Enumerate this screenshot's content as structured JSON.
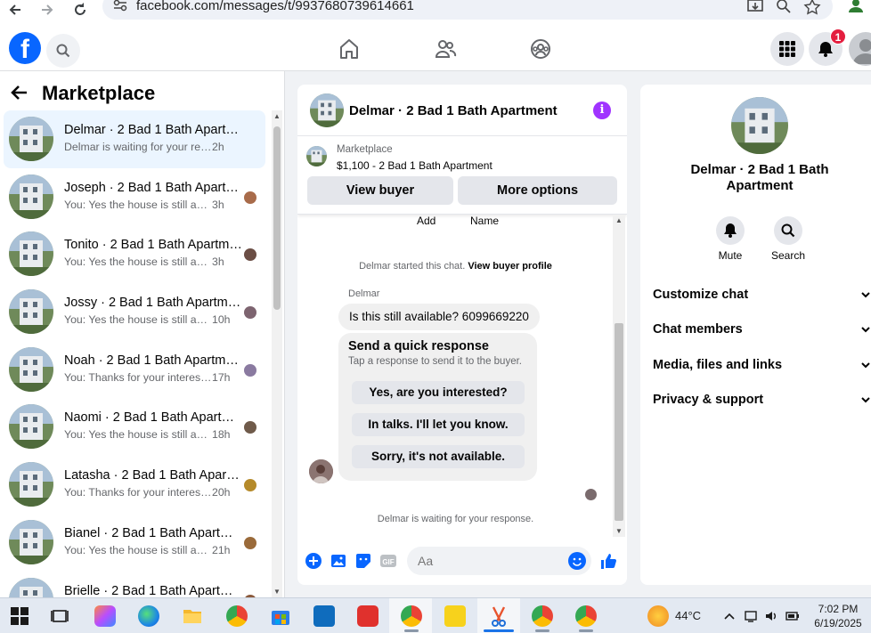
{
  "browser": {
    "url": "facebook.com/messages/t/9937680739614661"
  },
  "topnav": {
    "logo": "f",
    "notification_count": "1"
  },
  "sidebar": {
    "title": "Marketplace",
    "conversations": [
      {
        "title": "Delmar · 2 Bad 1 Bath Apartment",
        "preview": "Delmar is waiting for your response. ·",
        "time": "2h",
        "active": true
      },
      {
        "title": "Joseph · 2 Bad 1 Bath Apartment",
        "preview": "You: Yes the house is still available",
        "time": "3h"
      },
      {
        "title": "Tonito · 2 Bad 1 Bath Apartment",
        "preview": "You: Yes the house is still available",
        "time": "3h"
      },
      {
        "title": "Jossy · 2 Bad 1 Bath Apartment",
        "preview": "You: Yes the house is still available",
        "time": "10h"
      },
      {
        "title": "Noah · 2 Bad 1 Bath Apartment",
        "preview": "You: Thanks for your interest in th...",
        "time": "17h"
      },
      {
        "title": "Naomi · 2 Bad 1 Bath Apartment",
        "preview": "You: Yes the house is still available",
        "time": "18h"
      },
      {
        "title": "Latasha · 2 Bad 1 Bath Apartment",
        "preview": "You: Thanks for your interest in",
        "time": "20h"
      },
      {
        "title": "Bianel · 2 Bad 1 Bath Apartment",
        "preview": "You: Yes the house is still available",
        "time": "21h"
      },
      {
        "title": "Brielle · 2 Bad 1 Bath Apartment",
        "preview": "",
        "time": ""
      }
    ]
  },
  "chat": {
    "title": "Delmar · 2 Bad 1 Bath Apartment",
    "marketplace_label": "Marketplace",
    "listing": "$1,100 - 2 Bad 1 Bath Apartment",
    "view_buyer": "View buyer",
    "more_options": "More options",
    "cut_add": "Add",
    "cut_name": "Name",
    "started_text": "Delmar started this chat.",
    "view_profile": "View buyer profile",
    "sender": "Delmar",
    "message": "Is this still available? 6099669220",
    "quick_title": "Send a quick response",
    "quick_sub": "Tap a response to send it to the buyer.",
    "quick_options": [
      "Yes, are you interested?",
      "In talks. I'll let you know.",
      "Sorry, it's not available."
    ],
    "waiting": "Delmar is waiting for your response.",
    "input_placeholder": "Aa",
    "gif_label": "GIF"
  },
  "details": {
    "name": "Delmar · 2 Bad 1 Bath Apartment",
    "mute": "Mute",
    "search": "Search",
    "rows": [
      "Customize chat",
      "Chat members",
      "Media, files and links",
      "Privacy & support"
    ]
  },
  "taskbar": {
    "temperature": "44°C",
    "time": "7:02 PM",
    "date": "6/19/2025"
  },
  "colors": {
    "facebook_blue": "#0866ff",
    "active_row": "#ebf5ff",
    "info_purple": "#a033ff",
    "badge_red": "#e41e3f"
  }
}
